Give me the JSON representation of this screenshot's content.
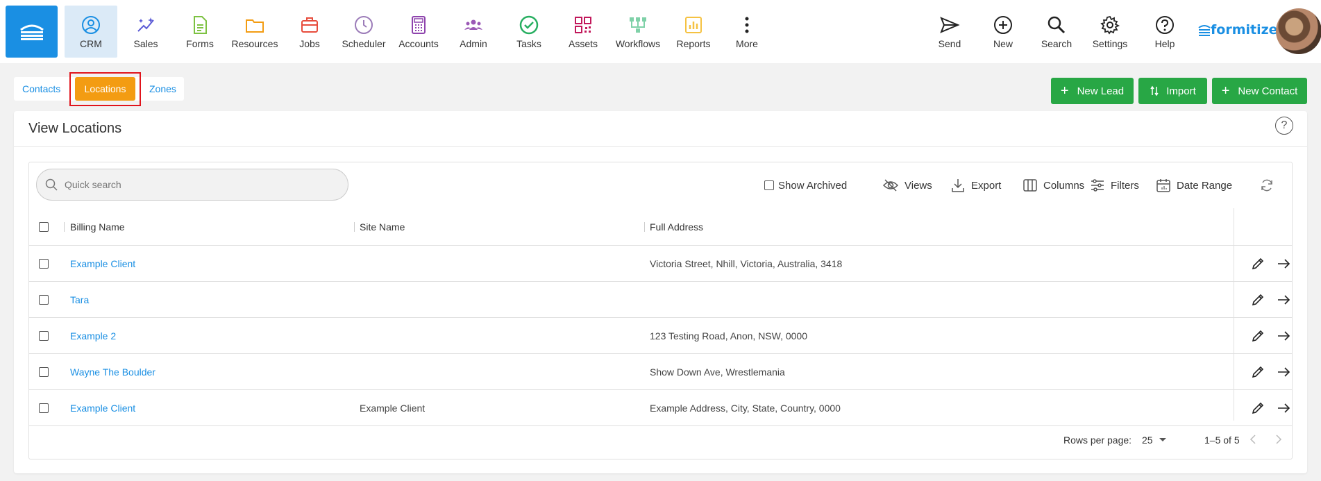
{
  "nav": {
    "items": [
      {
        "label": "CRM",
        "icon": "user-circle-icon",
        "color": "#1a8fe3"
      },
      {
        "label": "Sales",
        "icon": "sparkle-chart-icon",
        "color": "#5b5bd6"
      },
      {
        "label": "Forms",
        "icon": "document-icon",
        "color": "#7dc242"
      },
      {
        "label": "Resources",
        "icon": "folder-icon",
        "color": "#f39c12"
      },
      {
        "label": "Jobs",
        "icon": "briefcase-icon",
        "color": "#e74c3c"
      },
      {
        "label": "Scheduler",
        "icon": "clock-icon",
        "color": "#9b7bb8"
      },
      {
        "label": "Accounts",
        "icon": "calculator-icon",
        "color": "#8e44ad"
      },
      {
        "label": "Admin",
        "icon": "users-icon",
        "color": "#9b59b6"
      },
      {
        "label": "Tasks",
        "icon": "check-circle-icon",
        "color": "#27ae60"
      },
      {
        "label": "Assets",
        "icon": "qr-code-icon",
        "color": "#c2185b"
      },
      {
        "label": "Workflows",
        "icon": "workflow-icon",
        "color": "#27ae60"
      },
      {
        "label": "Reports",
        "icon": "bar-chart-icon",
        "color": "#f5c242"
      },
      {
        "label": "More",
        "icon": "more-vertical-icon",
        "color": "#222"
      }
    ],
    "right_items": [
      {
        "label": "Send",
        "icon": "send-icon"
      },
      {
        "label": "New",
        "icon": "plus-circle-icon"
      },
      {
        "label": "Search",
        "icon": "search-icon"
      },
      {
        "label": "Settings",
        "icon": "gear-icon"
      },
      {
        "label": "Help",
        "icon": "help-circle-icon"
      }
    ],
    "brand": "formitize",
    "accent": "#1a8fe3"
  },
  "subtabs": {
    "contacts": "Contacts",
    "locations": "Locations",
    "zones": "Zones"
  },
  "actions": {
    "new_lead": "New Lead",
    "import": "Import",
    "new_contact": "New Contact"
  },
  "card": {
    "title": "View Locations",
    "help": "?"
  },
  "toolbar": {
    "search_placeholder": "Quick search",
    "show_archived": "Show Archived",
    "views": "Views",
    "export": "Export",
    "columns": "Columns",
    "filters": "Filters",
    "date_range": "Date Range"
  },
  "table": {
    "headers": {
      "billing_name": "Billing Name",
      "site_name": "Site Name",
      "full_address": "Full Address"
    },
    "rows": [
      {
        "billing_name": "Example Client",
        "site_name": "",
        "full_address": "Victoria Street, Nhill, Victoria, Australia, 3418"
      },
      {
        "billing_name": "Tara",
        "site_name": "",
        "full_address": ""
      },
      {
        "billing_name": "Example 2",
        "site_name": "",
        "full_address": "123 Testing Road, Anon, NSW, 0000"
      },
      {
        "billing_name": "Wayne The Boulder",
        "site_name": "",
        "full_address": "Show Down Ave, Wrestlemania"
      },
      {
        "billing_name": "Example Client",
        "site_name": "Example Client",
        "full_address": "Example Address, City, State, Country, 0000"
      }
    ]
  },
  "footer": {
    "rows_per_page_label": "Rows per page:",
    "rows_per_page_value": "25",
    "range": "1–5 of 5"
  }
}
